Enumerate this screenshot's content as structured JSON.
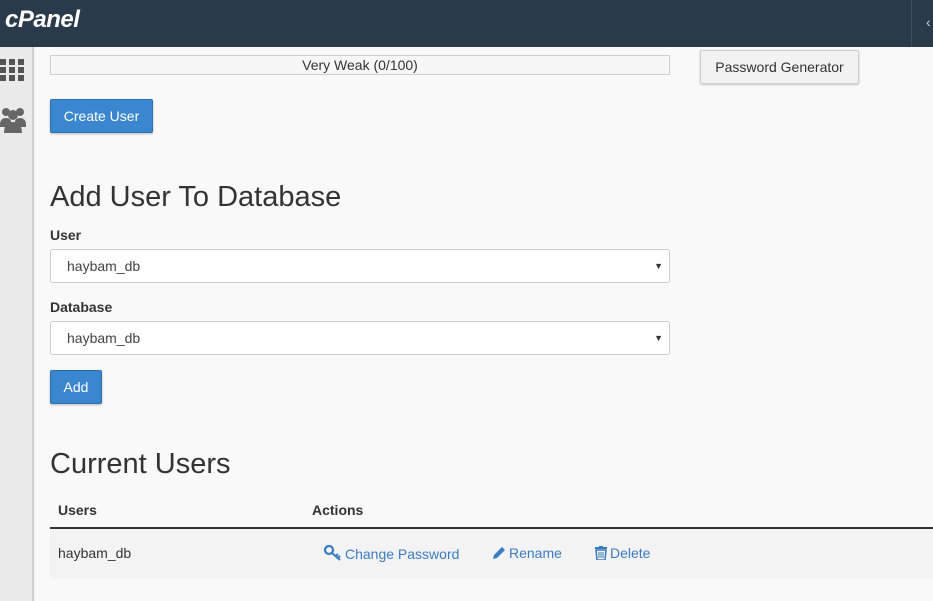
{
  "app": {
    "logo_text": "cPanel",
    "topbar_arrow": "‹"
  },
  "sidebar": {
    "icons": [
      "grid-icon",
      "users-icon"
    ]
  },
  "create_user": {
    "strength_text": "Very Weak (0/100)",
    "password_generator_label": "Password Generator",
    "create_button_label": "Create User"
  },
  "add_user_to_db": {
    "title": "Add User To Database",
    "user_label": "User",
    "user_value": "haybam_db",
    "database_label": "Database",
    "database_value": "haybam_db",
    "add_button_label": "Add"
  },
  "current_users": {
    "title": "Current Users",
    "columns": {
      "users": "Users",
      "actions": "Actions"
    },
    "rows": [
      {
        "user": "haybam_db",
        "actions": [
          {
            "label": "Change Password",
            "icon": "key-icon"
          },
          {
            "label": "Rename",
            "icon": "pencil-icon"
          },
          {
            "label": "Delete",
            "icon": "trash-icon"
          }
        ]
      }
    ]
  },
  "colors": {
    "topbar": "#293a4a",
    "primary": "#3a87d0",
    "link": "#3a7cc4"
  }
}
